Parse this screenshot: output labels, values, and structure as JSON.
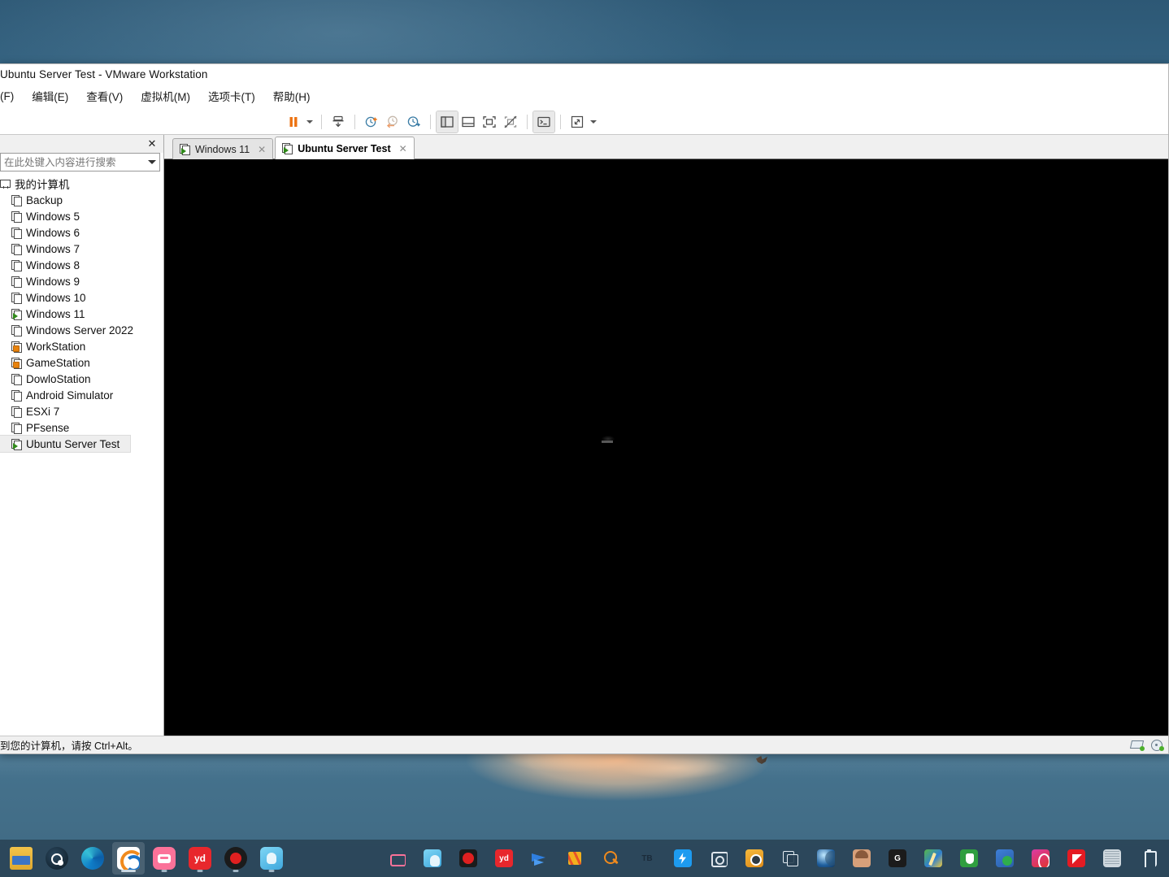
{
  "window": {
    "title": "Ubuntu Server Test - VMware Workstation",
    "menu": [
      "(F)",
      "编辑(E)",
      "查看(V)",
      "虚拟机(M)",
      "选项卡(T)",
      "帮助(H)"
    ],
    "toolbar": [
      {
        "name": "suspend-button",
        "icon": "pause-icon"
      },
      {
        "name": "suspend-dropdown",
        "icon": "chevron-down-icon"
      },
      {
        "name": "power-button",
        "icon": "power-download-icon"
      },
      {
        "name": "take-snapshot-button",
        "icon": "snapshot-add-icon"
      },
      {
        "name": "revert-snapshot-button",
        "icon": "snapshot-revert-icon"
      },
      {
        "name": "snapshot-manager-button",
        "icon": "snapshot-manager-icon"
      },
      {
        "name": "show-library-button",
        "icon": "panel-left-icon"
      },
      {
        "name": "show-thumbnail-bar-button",
        "icon": "panel-bottom-icon"
      },
      {
        "name": "console-view-button",
        "icon": "fit-window-icon"
      },
      {
        "name": "fit-guest-button",
        "icon": "fit-guest-off-icon"
      },
      {
        "name": "unity-button",
        "icon": "terminal-icon"
      },
      {
        "name": "fullscreen-button",
        "icon": "expand-icon"
      },
      {
        "name": "fullscreen-dropdown",
        "icon": "chevron-down-icon"
      }
    ]
  },
  "sidebar": {
    "close_label": "✕",
    "search": {
      "value": "",
      "placeholder": "在此处键入内容进行搜索"
    },
    "root": {
      "label": "我的计算机",
      "icon": "monitor-icon"
    },
    "items": [
      {
        "label": "Backup",
        "state": "off"
      },
      {
        "label": "Windows 5",
        "state": "off"
      },
      {
        "label": "Windows 6",
        "state": "off"
      },
      {
        "label": "Windows 7",
        "state": "off"
      },
      {
        "label": "Windows 8",
        "state": "off"
      },
      {
        "label": "Windows 9",
        "state": "off"
      },
      {
        "label": "Windows 10",
        "state": "off"
      },
      {
        "label": "Windows 11",
        "state": "running"
      },
      {
        "label": "Windows Server 2022",
        "state": "off"
      },
      {
        "label": "WorkStation",
        "state": "suspended"
      },
      {
        "label": "GameStation",
        "state": "suspended"
      },
      {
        "label": "DowloStation",
        "state": "off"
      },
      {
        "label": "Android Simulator",
        "state": "off"
      },
      {
        "label": "ESXi 7",
        "state": "off"
      },
      {
        "label": "PFsense",
        "state": "off"
      },
      {
        "label": "Ubuntu Server Test",
        "state": "running",
        "selected": true
      }
    ]
  },
  "tabs": [
    {
      "label": "Windows 11",
      "state": "running",
      "active": false,
      "close": "✕"
    },
    {
      "label": "Ubuntu Server Test",
      "state": "running",
      "active": true,
      "close": "✕"
    }
  ],
  "statusbar": {
    "message": "到您的计算机，请按 Ctrl+Alt。",
    "devices": [
      {
        "name": "network-adapter-indicator",
        "icon": "network-icon"
      },
      {
        "name": "cd-dvd-indicator",
        "icon": "cd-icon"
      }
    ]
  },
  "taskbar": {
    "pinned": [
      {
        "name": "file-explorer",
        "icon": "folder-icon",
        "running": false
      },
      {
        "name": "steam",
        "icon": "steam-icon",
        "running": false
      },
      {
        "name": "microsoft-edge",
        "icon": "edge-icon",
        "running": false
      },
      {
        "name": "vmware-workstation",
        "icon": "vmware-icon",
        "running": true,
        "active": true
      },
      {
        "name": "bilibili",
        "icon": "bilibili-icon",
        "running": true
      },
      {
        "name": "youdao",
        "icon": "yd-icon",
        "label": "yd",
        "running": true
      },
      {
        "name": "screen-recorder",
        "icon": "record-icon",
        "running": true
      },
      {
        "name": "game-launcher",
        "icon": "game-icon",
        "running": true
      }
    ],
    "tray": [
      {
        "name": "bilibili-tray",
        "icon": "bilibili-outline-icon"
      },
      {
        "name": "game-tray",
        "icon": "game-icon"
      },
      {
        "name": "recorder-tray",
        "icon": "record-icon"
      },
      {
        "name": "youdao-tray",
        "icon": "yd-icon",
        "label": "yd"
      },
      {
        "name": "arrow-tray",
        "icon": "blue-arrow-icon"
      },
      {
        "name": "bars-tray",
        "icon": "color-bars-icon"
      },
      {
        "name": "search-tray",
        "icon": "search-icon"
      },
      {
        "name": "taobao-tray",
        "icon": "tb-icon",
        "label": "TB"
      },
      {
        "name": "thunder-tray",
        "icon": "bolt-icon"
      },
      {
        "name": "camera-tray",
        "icon": "camera-icon"
      },
      {
        "name": "snapshot-tray",
        "icon": "camera-yellow-icon"
      },
      {
        "name": "clipboard-tray",
        "icon": "copy-icon"
      },
      {
        "name": "browser-tray",
        "icon": "moon-icon"
      },
      {
        "name": "account-tray",
        "icon": "avatar-icon"
      },
      {
        "name": "logitech-tray",
        "icon": "logitech-icon",
        "label": "G"
      },
      {
        "name": "paint-tray",
        "icon": "paint-icon"
      },
      {
        "name": "antivirus-tray",
        "icon": "shield-icon"
      },
      {
        "name": "security-tray",
        "icon": "security-check-icon"
      },
      {
        "name": "media-tray",
        "icon": "pink-app-icon"
      },
      {
        "name": "amd-tray",
        "icon": "amd-icon"
      },
      {
        "name": "display-tray",
        "icon": "display-icon"
      },
      {
        "name": "usb-eject-tray",
        "icon": "usb-icon"
      }
    ]
  }
}
